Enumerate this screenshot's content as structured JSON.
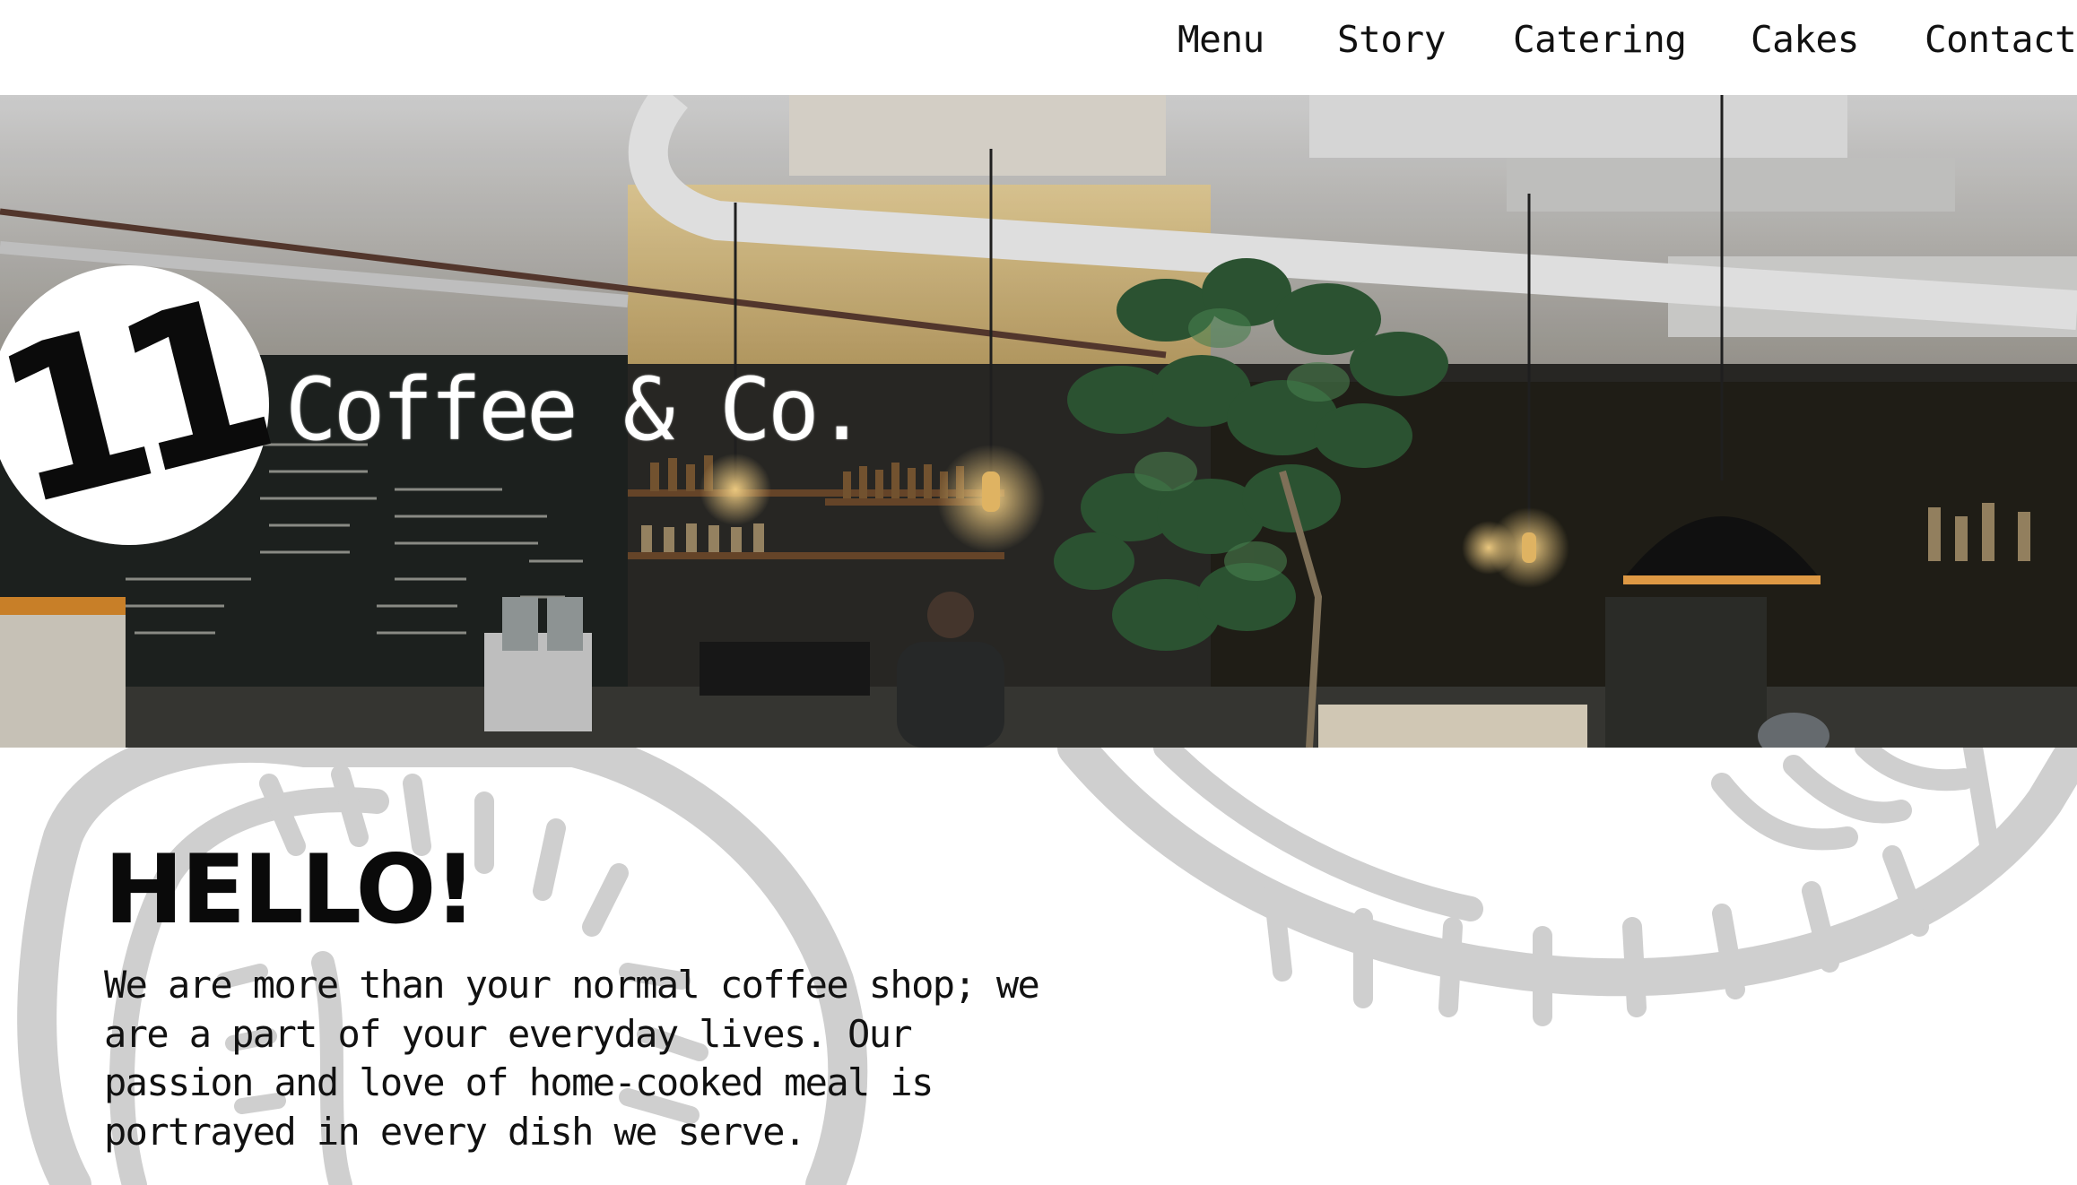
{
  "nav": {
    "items": [
      {
        "label": "Menu"
      },
      {
        "label": "Story"
      },
      {
        "label": "Catering"
      },
      {
        "label": "Cakes"
      },
      {
        "label": "Contact"
      }
    ]
  },
  "brand": {
    "logo_number": "11",
    "name": "Coffee & Co."
  },
  "intro": {
    "title": "HELLO!",
    "text": "We are more than your normal coffee shop; we are a part of your everyday lives. Our passion and love of home-cooked meal is portrayed in every dish we serve."
  },
  "colors": {
    "nav_background": "#ffffff",
    "text": "#111111",
    "watermark": "#cfcfcf",
    "logo_circle": "#ffffff"
  }
}
